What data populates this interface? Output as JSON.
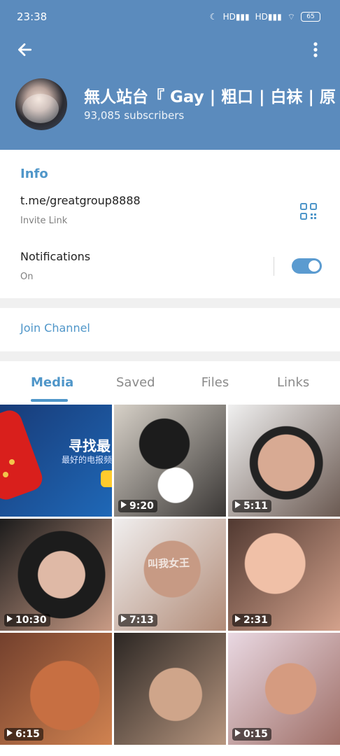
{
  "status_bar": {
    "time": "23:38",
    "network_labels": [
      "HD",
      "HD"
    ],
    "battery": "65"
  },
  "header": {
    "title": "無人站台『 Gay | 粗口 | 白袜 | 原",
    "subscribers": "93,085 subscribers",
    "colors": {
      "background": "#5b8bbd",
      "accent": "#4f96c9"
    }
  },
  "info": {
    "section_title": "Info",
    "invite_link": "t.me/greatgroup8888",
    "invite_label": "Invite Link",
    "notifications_label": "Notifications",
    "notifications_state": "On",
    "notifications_on": true
  },
  "actions": {
    "join_channel": "Join Channel"
  },
  "tabs": [
    {
      "label": "Media",
      "active": true
    },
    {
      "label": "Saved",
      "active": false
    },
    {
      "label": "Files",
      "active": false
    },
    {
      "label": "Links",
      "active": false
    }
  ],
  "media": [
    {
      "type": "promo",
      "text": "寻找最",
      "subtext": "最好的电报频",
      "colors": [
        "#183b78",
        "#1f68b7"
      ]
    },
    {
      "type": "video",
      "duration": "9:20",
      "colors": [
        "#d7d1c8",
        "#3a3735"
      ]
    },
    {
      "type": "video",
      "duration": "5:11",
      "colors": [
        "#f0f0f0",
        "#6b5a52"
      ]
    },
    {
      "type": "video",
      "duration": "10:30",
      "colors": [
        "#1c1c1c",
        "#c99b85"
      ]
    },
    {
      "type": "video",
      "duration": "7:13",
      "overlay_text": "叫我女王",
      "colors": [
        "#f0eeee",
        "#b18b77"
      ]
    },
    {
      "type": "video",
      "duration": "2:31",
      "colors": [
        "#513931",
        "#d3a18b"
      ]
    },
    {
      "type": "video",
      "duration": "6:15",
      "colors": [
        "#73402d",
        "#d08250"
      ]
    },
    {
      "type": "video",
      "duration": "",
      "colors": [
        "#2b2623",
        "#b7967f"
      ]
    },
    {
      "type": "video",
      "duration": "0:15",
      "colors": [
        "#e9d8e2",
        "#9f6f67"
      ]
    }
  ]
}
